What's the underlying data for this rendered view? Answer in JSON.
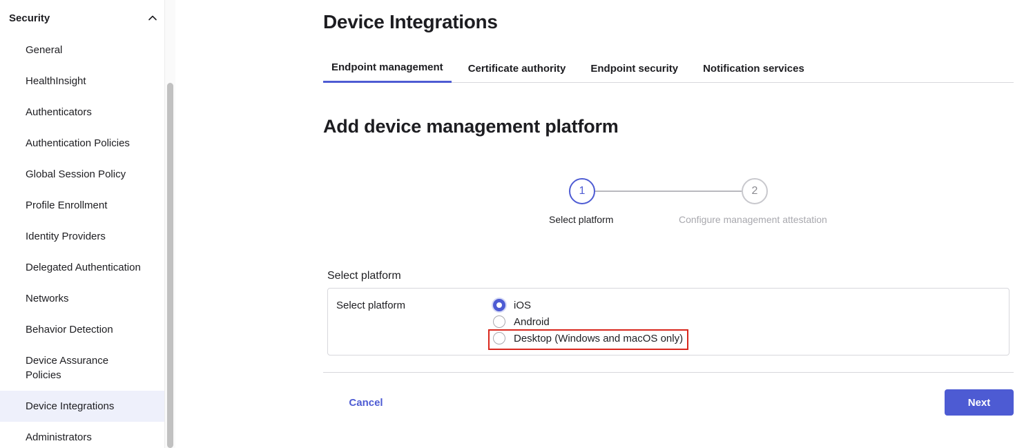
{
  "sidebar": {
    "section_title": "Security",
    "items": [
      {
        "label": "General"
      },
      {
        "label": "HealthInsight"
      },
      {
        "label": "Authenticators"
      },
      {
        "label": "Authentication Policies"
      },
      {
        "label": "Global Session Policy"
      },
      {
        "label": "Profile Enrollment"
      },
      {
        "label": "Identity Providers"
      },
      {
        "label": "Delegated Authentication"
      },
      {
        "label": "Networks"
      },
      {
        "label": "Behavior Detection"
      },
      {
        "label": "Device Assurance Policies"
      },
      {
        "label": "Device Integrations"
      },
      {
        "label": "Administrators"
      }
    ],
    "active_item": "Device Integrations"
  },
  "header": {
    "title": "Device Integrations"
  },
  "tabs": [
    {
      "label": "Endpoint management"
    },
    {
      "label": "Certificate authority"
    },
    {
      "label": "Endpoint security"
    },
    {
      "label": "Notification services"
    }
  ],
  "main": {
    "section_title": "Add device management platform",
    "stepper": {
      "steps": [
        {
          "number": "1",
          "label": "Select platform"
        },
        {
          "number": "2",
          "label": "Configure management attestation"
        }
      ]
    },
    "form": {
      "legend": "Select platform",
      "field_label": "Select platform",
      "options": [
        {
          "label": "iOS"
        },
        {
          "label": "Android"
        },
        {
          "label": "Desktop (Windows and macOS only)"
        }
      ],
      "selected": "iOS"
    },
    "actions": {
      "cancel_label": "Cancel",
      "next_label": "Next"
    }
  },
  "colors": {
    "accent": "#4d5bd3",
    "highlight": "#d9261c",
    "active_sidebar_bg": "#eef0fb"
  }
}
